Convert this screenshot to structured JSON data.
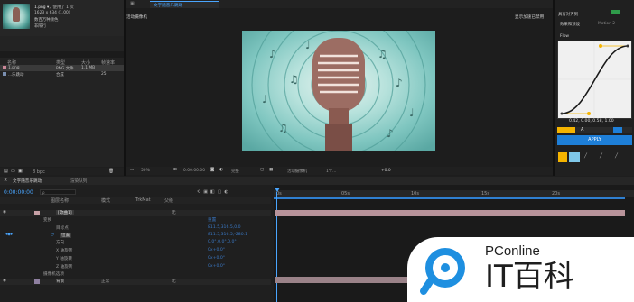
{
  "project": {
    "item_name": "1.png ▾",
    "usage": "，使用了 1 次",
    "dims": "1623 x 634 (1.00)",
    "info2": "数百万种颜色",
    "info3": "非隔行",
    "col_name": "名称",
    "col_type": "类型",
    "col_size": "大小",
    "col_rate": "帧速率",
    "rows": [
      {
        "name": "1.png",
        "type": "PNG 文件",
        "size": "1.1 MB",
        "rate": ""
      },
      {
        "name": "...乐跳动",
        "type": "合成",
        "size": "",
        "rate": "25"
      }
    ],
    "bpc": "8 bpc"
  },
  "composition": {
    "tab_label": "文字随音乐跳动",
    "active_camera": "活动摄像机",
    "renderer_label": "显示加速已禁用",
    "zoom": "50%",
    "timecode": "0:00:00:00",
    "resolution": "完整",
    "camera": "活动摄像机",
    "views": "1个...",
    "exposure": "+0.0"
  },
  "right_panel": {
    "tab1": "对齐",
    "tab2": "Motion 2",
    "tab3": "效果和预设",
    "tab4": "Flow",
    "label1": "具有对齐到",
    "flow_title": "Flow",
    "curve_values": "0.42, 0.00, 0.58, 1.00",
    "apply": "APPLY"
  },
  "timeline": {
    "tab1": "文字随音乐跳动",
    "tab2": "渲染队列",
    "timecode": "0:00:00:00",
    "search_placeholder": "ρ",
    "col_source": "图层名称",
    "col_mode": "模式",
    "col_trkmat": "TrkMat",
    "col_parent": "父级",
    "layer1_name": "[歌曲1]",
    "layer1_parent": "无",
    "transform": "变换",
    "reset": "重置",
    "props": [
      {
        "name": "目标点",
        "value": "811.5,316.5,0.0"
      },
      {
        "name": "位置",
        "value": "811.5,316.5,-280.1"
      },
      {
        "name": "方向",
        "value": "0.0°,0.0°,0.0°"
      },
      {
        "name": "X 轴旋转",
        "value": "0x+0.0°"
      },
      {
        "name": "Y 轴旋转",
        "value": "0x+0.0°"
      },
      {
        "name": "Z 轴旋转",
        "value": "0x+0.0°"
      }
    ],
    "camera_options": "摄像机选项",
    "layer2_name": "背景",
    "layer2_mode": "正常",
    "layer2_parent": "无",
    "ruler": [
      "0s",
      "05s",
      "10s",
      "15s",
      "20s"
    ]
  },
  "watermark": {
    "brand": "PConline",
    "cn": "IT百科",
    "accent": "#1e8fe0"
  }
}
